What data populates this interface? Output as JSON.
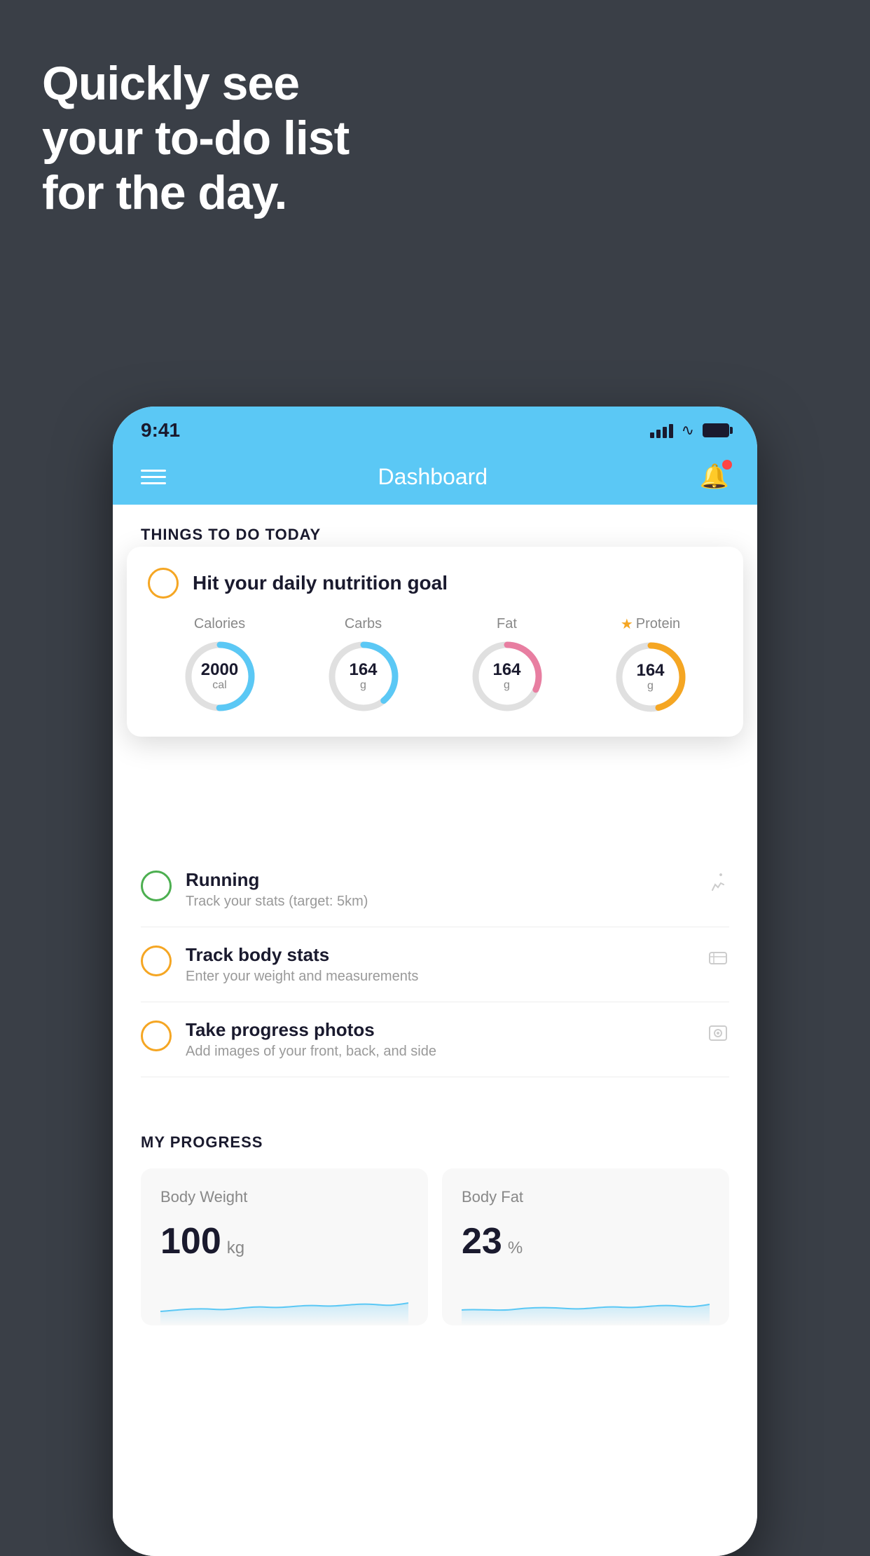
{
  "hero": {
    "line1": "Quickly see",
    "line2": "your to-do list",
    "line3": "for the day."
  },
  "status_bar": {
    "time": "9:41"
  },
  "nav": {
    "title": "Dashboard"
  },
  "things_today": {
    "header": "THINGS TO DO TODAY"
  },
  "nutrition_card": {
    "title": "Hit your daily nutrition goal",
    "metrics": [
      {
        "label": "Calories",
        "value": "2000",
        "unit": "cal",
        "color": "#5bc8f5",
        "starred": false
      },
      {
        "label": "Carbs",
        "value": "164",
        "unit": "g",
        "color": "#5bc8f5",
        "starred": false
      },
      {
        "label": "Fat",
        "value": "164",
        "unit": "g",
        "color": "#e87ea1",
        "starred": false
      },
      {
        "label": "Protein",
        "value": "164",
        "unit": "g",
        "color": "#f5a623",
        "starred": true
      }
    ]
  },
  "todo_items": [
    {
      "title": "Running",
      "subtitle": "Track your stats (target: 5km)",
      "circle_color": "green",
      "icon": "👟"
    },
    {
      "title": "Track body stats",
      "subtitle": "Enter your weight and measurements",
      "circle_color": "yellow",
      "icon": "⊞"
    },
    {
      "title": "Take progress photos",
      "subtitle": "Add images of your front, back, and side",
      "circle_color": "yellow",
      "icon": "👤"
    }
  ],
  "progress": {
    "header": "MY PROGRESS",
    "cards": [
      {
        "title": "Body Weight",
        "value": "100",
        "unit": "kg"
      },
      {
        "title": "Body Fat",
        "value": "23",
        "unit": "%"
      }
    ]
  }
}
